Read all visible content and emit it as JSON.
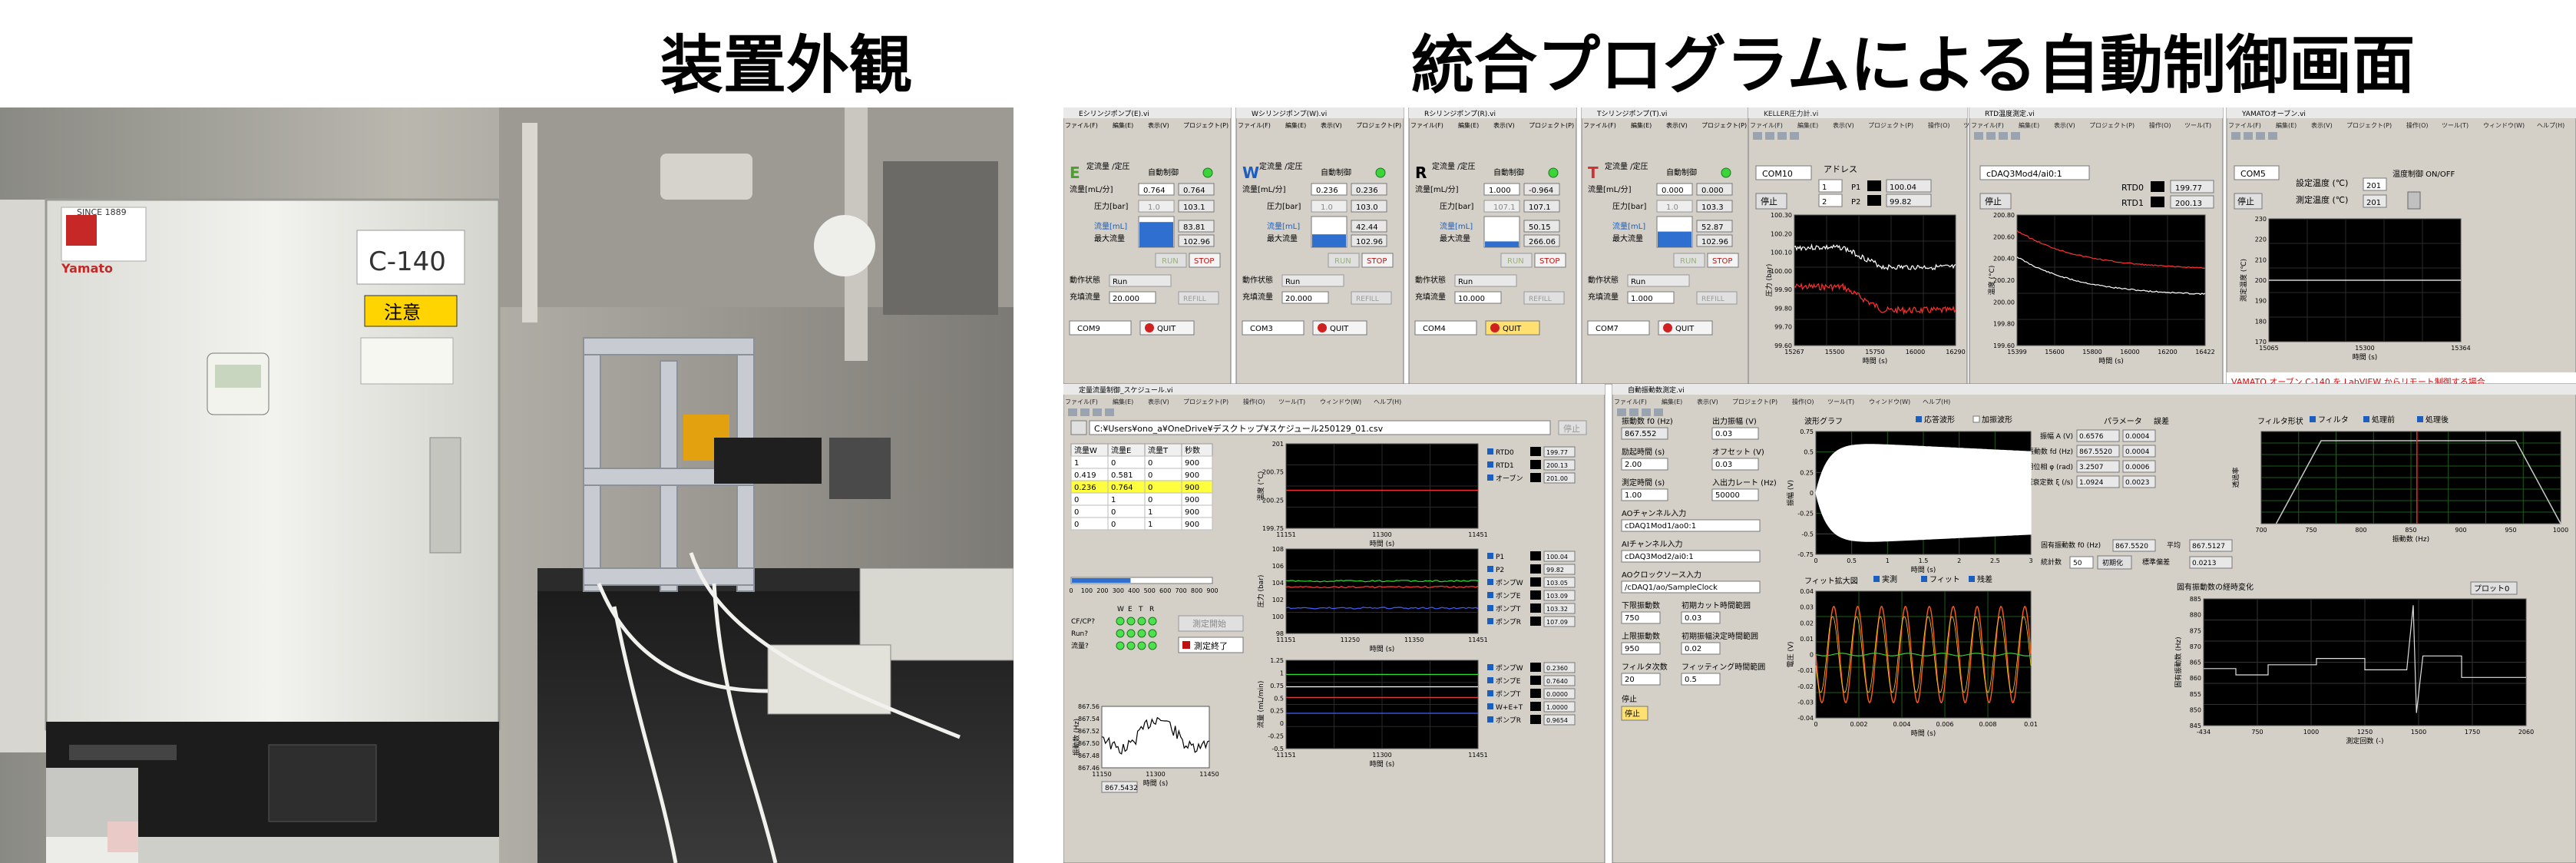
{
  "headings": {
    "left": "装置外観",
    "right": "統合プログラムによる自動制御画面"
  },
  "photo": {
    "panel_text_since": "SINCE 1889",
    "panel_brand": "Yamato",
    "panel_model": "C-140",
    "panel_caution": "注意"
  },
  "menu": {
    "items": [
      "ファイル(F)",
      "編集(E)",
      "表示(V)",
      "プロジェクト(P)",
      "操作(O)",
      "ツール(T)",
      "ウィンドウ(W)",
      "ヘルプ(H)"
    ]
  },
  "pump_windows": [
    {
      "title": "Eシリンジポンプ(E).vi",
      "letter": "E",
      "letter_color": "#4aa02c",
      "mode_label": "定流量 /定圧",
      "auto_label": "自動制御",
      "flow_label": "流量[mL/分]",
      "flow_set": "0.764",
      "flow_val": "0.764",
      "press_label": "圧力[bar]",
      "press_set": "1.0",
      "press_val": "103.1",
      "vol_label": "流量[mL]",
      "vol_val": "83.81",
      "max_label": "最大流量",
      "max_val": "102.96",
      "fill_level": 0.82,
      "run": "RUN",
      "stop": "STOP",
      "state_label": "動作状態",
      "state_val": "Run",
      "fill_label": "充填流量",
      "fill_val": "20.000",
      "refill": "REFILL",
      "com": "COM9",
      "quit": "QUIT"
    },
    {
      "title": "Wシリンジポンプ(W).vi",
      "letter": "W",
      "letter_color": "#1a5fc0",
      "mode_label": "定流量 /定圧",
      "auto_label": "自動制御",
      "flow_label": "流量[mL/分]",
      "flow_set": "0.236",
      "flow_val": "0.236",
      "press_label": "圧力[bar]",
      "press_set": "1.0",
      "press_val": "103.0",
      "vol_label": "流量[mL]",
      "vol_val": "42.44",
      "max_label": "最大流量",
      "max_val": "102.96",
      "fill_level": 0.42,
      "run": "RUN",
      "stop": "STOP",
      "state_label": "動作状態",
      "state_val": "Run",
      "fill_label": "充填流量",
      "fill_val": "20.000",
      "refill": "REFILL",
      "com": "COM3",
      "quit": "QUIT"
    },
    {
      "title": "Rシリンジポンプ(R).vi",
      "letter": "R",
      "letter_color": "#000000",
      "mode_label": "定流量 /定圧",
      "auto_label": "自動制御",
      "flow_label": "流量[mL/分]",
      "flow_set": "1.000",
      "flow_val": "-0.964",
      "press_label": "圧力[bar]",
      "press_set": "107.1",
      "press_val": "107.1",
      "vol_label": "流量[mL]",
      "vol_val": "50.15",
      "max_label": "最大流量",
      "max_val": "266.06",
      "fill_level": 0.19,
      "run": "RUN",
      "stop": "STOP",
      "state_label": "動作状態",
      "state_val": "Run",
      "fill_label": "充填流量",
      "fill_val": "10.000",
      "refill": "REFILL",
      "com": "COM4",
      "quit": "QUIT"
    },
    {
      "title": "Tシリンジポンプ(T).vi",
      "letter": "T",
      "letter_color": "#d03030",
      "mode_label": "定流量 /定圧",
      "auto_label": "自動制御",
      "flow_label": "流量[mL/分]",
      "flow_set": "0.000",
      "flow_val": "0.000",
      "press_label": "圧力[bar]",
      "press_set": "1.0",
      "press_val": "103.3",
      "vol_label": "流量[mL]",
      "vol_val": "52.87",
      "max_label": "最大流量",
      "max_val": "102.96",
      "fill_level": 0.51,
      "run": "RUN",
      "stop": "STOP",
      "state_label": "動作状態",
      "state_val": "Run",
      "fill_label": "充填流量",
      "fill_val": "1.000",
      "refill": "REFILL",
      "com": "COM7",
      "quit": "QUIT"
    }
  ],
  "pressure_window": {
    "title": "KELLER圧力計.vi",
    "com": "COM10",
    "addr_label": "アドレス",
    "addr1": "1",
    "addr2": "2",
    "p1_label": "P1",
    "p1_val": "100.04",
    "p2_label": "P2",
    "p2_val": "99.82",
    "stop": "停止",
    "ylabel": "圧力 (bar)",
    "xlabel": "時間 (s)",
    "yticks": [
      "100.30",
      "100.20",
      "100.10",
      "100.00",
      "99.90",
      "99.80",
      "99.70",
      "99.60"
    ],
    "xticks": [
      "15267",
      "15500",
      "15750",
      "16000",
      "16290"
    ]
  },
  "temp_window": {
    "title": "RTD温度測定.vi",
    "channel": "cDAQ3Mod4/ai0:1",
    "stop": "停止",
    "rtd0_label": "RTD0",
    "rtd0_val": "199.77",
    "rtd1_label": "RTD1",
    "rtd1_val": "200.13",
    "ylabel": "温度 (°C)",
    "xlabel": "時間 (s)",
    "yticks": [
      "200.80",
      "200.60",
      "200.40",
      "200.20",
      "200.00",
      "199.80",
      "199.60"
    ],
    "xticks": [
      "15399",
      "15600",
      "15800",
      "16000",
      "16200",
      "16422"
    ]
  },
  "oven_window": {
    "title": "YAMATOオーブン.vi",
    "com": "COM5",
    "stop": "停止",
    "set_label": "設定温度 (℃)",
    "set_val": "201",
    "meas_label": "測定温度 (℃)",
    "meas_val": "201",
    "control_label": "温度制御 ON/OFF",
    "ylabel": "測定温度 (℃)",
    "xlabel": "時間 (s)",
    "yticks": [
      "230",
      "220",
      "210",
      "200",
      "190",
      "180",
      "170"
    ],
    "xticks": [
      "15065",
      "15300",
      "15364"
    ],
    "status": "VAMATO オーブン C-140 を LabVIEW からリモート制御する場合..."
  },
  "schedule_window": {
    "title": "定量流量制御_スケジュール.vi",
    "path": "C:¥Users¥ono_a¥OneDrive¥デスクトップ¥スケジュール250129_01.csv",
    "stop": "停止",
    "table_headers": [
      "流量W",
      "流量E",
      "流量T",
      "秒数"
    ],
    "table_rows": [
      [
        "1",
        "0",
        "0",
        "900"
      ],
      [
        "0.419",
        "0.581",
        "0",
        "900"
      ],
      [
        "0.236",
        "0.764",
        "0",
        "900"
      ],
      [
        "0",
        "1",
        "0",
        "900"
      ],
      [
        "0",
        "0",
        "1",
        "900"
      ],
      [
        "0",
        "0",
        "1",
        "900"
      ]
    ],
    "progress_ticks": [
      "0",
      "100",
      "200",
      "300",
      "400",
      "500",
      "600",
      "700",
      "800",
      "900"
    ],
    "progress": 0.42,
    "led_header": [
      "W",
      "E",
      "T",
      "R"
    ],
    "led_rows": [
      "CF/CP?",
      "Run?",
      "流量?"
    ],
    "start_button": "測定開始",
    "end_button": "測定終了",
    "freq_ylabel": "振動数 (Hz)",
    "freq_yticks": [
      "867.56",
      "867.54",
      "867.52",
      "867.50",
      "867.48",
      "867.46"
    ],
    "freq_xticks": [
      "11150",
      "11300",
      "11450"
    ],
    "freq_xlabel": "時間 (s)",
    "freq_val": "867.5432",
    "temp_ylabel": "温度 (°C)",
    "temp_yticks": [
      "201",
      "200.75",
      "200.25",
      "199.75"
    ],
    "temp_xticks": [
      "11151",
      "11300",
      "11451"
    ],
    "temp_xlabel": "時間 (s)",
    "temp_legend": [
      {
        "label": "RTD0",
        "val": "199.77"
      },
      {
        "label": "RTD1",
        "val": "200.13"
      },
      {
        "label": "オーブン",
        "val": "201.00"
      }
    ],
    "press_ylabel": "圧力 (bar)",
    "press_yticks": [
      "108",
      "106",
      "104",
      "102",
      "100",
      "98"
    ],
    "press_xticks": [
      "11151",
      "11250",
      "11350",
      "11451"
    ],
    "press_xlabel": "時間 (s)",
    "press_legend": [
      {
        "label": "P1",
        "val": "100.04"
      },
      {
        "label": "P2",
        "val": "99.82"
      },
      {
        "label": "ポンプW",
        "val": "103.05"
      },
      {
        "label": "ポンプE",
        "val": "103.09"
      },
      {
        "label": "ポンプT",
        "val": "103.32"
      },
      {
        "label": "ポンプR",
        "val": "107.09"
      }
    ],
    "flow_ylabel": "流量 (mL/min)",
    "flow_yticks": [
      "1.25",
      "1",
      "0.75",
      "0.5",
      "0.25",
      "0",
      "-0.25",
      "-0.5"
    ],
    "flow_xticks": [
      "11151",
      "11300",
      "11451"
    ],
    "flow_xlabel": "時間 (s)",
    "flow_legend": [
      {
        "label": "ポンプW",
        "val": "0.2360"
      },
      {
        "label": "ポンプE",
        "val": "0.7640"
      },
      {
        "label": "ポンプT",
        "val": "0.0000"
      },
      {
        "label": "W+E+T",
        "val": "1.0000"
      },
      {
        "label": "ポンプR",
        "val": "0.9654"
      }
    ]
  },
  "density_window": {
    "title": "自動振動数測定.vi",
    "f0_label": "振動数 f0 (Hz)",
    "f0_val": "867.552",
    "amp_label": "出力振幅 (V)",
    "amp_val": "0.03",
    "exc_label": "励起時間 (s)",
    "exc_val": "2.00",
    "offset_label": "オフセット (V)",
    "offset_val": "0.03",
    "meas_label": "測定時間 (s)",
    "meas_val": "1.00",
    "rate_label": "入出力レート (Hz)",
    "rate_val": "50000",
    "ao_label": "AOチャンネル入力",
    "ao_val": "cDAQ1Mod1/ao0:1",
    "ai_label": "AIチャンネル入力",
    "ai_val": "cDAQ3Mod2/ai0:1",
    "clk_label": "AOクロックソース入力",
    "clk_val": "/cDAQ1/ao/SampleClock",
    "low_label": "下限振動数",
    "low_val": "750",
    "high_label": "上限振動数",
    "high_val": "950",
    "fnum_label": "フィルタ次数",
    "fnum_val": "20",
    "cut_label": "初期カット時間範囲",
    "cut_val": "0.03",
    "dec_label": "初期振幅決定時間範囲",
    "dec_val": "0.02",
    "fit_label": "フィッティング時間範囲",
    "fit_val": "0.5",
    "stop": "停止",
    "wave_title": "波形グラフ",
    "wave_opt1": "応答波形",
    "wave_opt2": "加振波形",
    "wave_ylabel": "振幅 (V)",
    "wave_xlabel": "時間 (s)",
    "wave_yticks": [
      "0.75",
      "0.5",
      "0.25",
      "0",
      "-0.25",
      "-0.5",
      "-0.75"
    ],
    "wave_xticks": [
      "0",
      "0.5",
      "1",
      "1.5",
      "2",
      "2.5",
      "3"
    ],
    "fit_title": "フィット拡大図",
    "fit_opt1": "実測",
    "fit_opt2": "フィット",
    "fit_opt3": "残差",
    "fit_ylabel": "電圧 (V)",
    "fit_xlabel": "時間 (s)",
    "fit_yticks": [
      "0.04",
      "0.03",
      "0.02",
      "0.01",
      "0",
      "-0.01",
      "-0.02",
      "-0.03",
      "-0.04"
    ],
    "fit_xticks": [
      "0",
      "0.002",
      "0.004",
      "0.006",
      "0.008",
      "0.01"
    ],
    "param_title": "パラメータ",
    "err_title": "誤差",
    "params": [
      {
        "label": "振幅 A (V)",
        "val": "0.6576",
        "err": "0.0004"
      },
      {
        "label": "減衰振動数 fd (Hz)",
        "val": "867.5520",
        "err": "0.0004"
      },
      {
        "label": "初期位相 φ (rad)",
        "val": "3.2507",
        "err": "0.0006"
      },
      {
        "label": "減衰定数 ξ (/s)",
        "val": "1.0924",
        "err": "0.0023"
      }
    ],
    "nat_label": "固有振動数 f0 (Hz)",
    "nat_val": "867.5520",
    "avg_label": "平均",
    "avg_val": "867.5127",
    "count_label": "統計数",
    "count_val": "50",
    "init_button": "初期化",
    "sd_label": "標準偏差",
    "sd_val": "0.0213",
    "filter_title": "フィルタ形状",
    "filter_opt1": "フィルタ",
    "filter_opt2": "処理前",
    "filter_opt3": "処理後",
    "filter_ylabel": "透過率",
    "filter_xlabel": "振動数 (Hz)",
    "filter_xticks": [
      "700",
      "750",
      "800",
      "850",
      "900",
      "950",
      "1000"
    ],
    "trend_title": "固有振動数の経時変化",
    "trend_plot": "プロット0",
    "trend_ylabel": "固有振動数 (Hz)",
    "trend_xlabel": "測定回数 (-)",
    "trend_yticks": [
      "885",
      "880",
      "875",
      "870",
      "865",
      "860",
      "855",
      "850",
      "845"
    ],
    "trend_xticks": [
      "-434",
      "750",
      "1000",
      "1250",
      "1500",
      "1750",
      "2060"
    ]
  }
}
